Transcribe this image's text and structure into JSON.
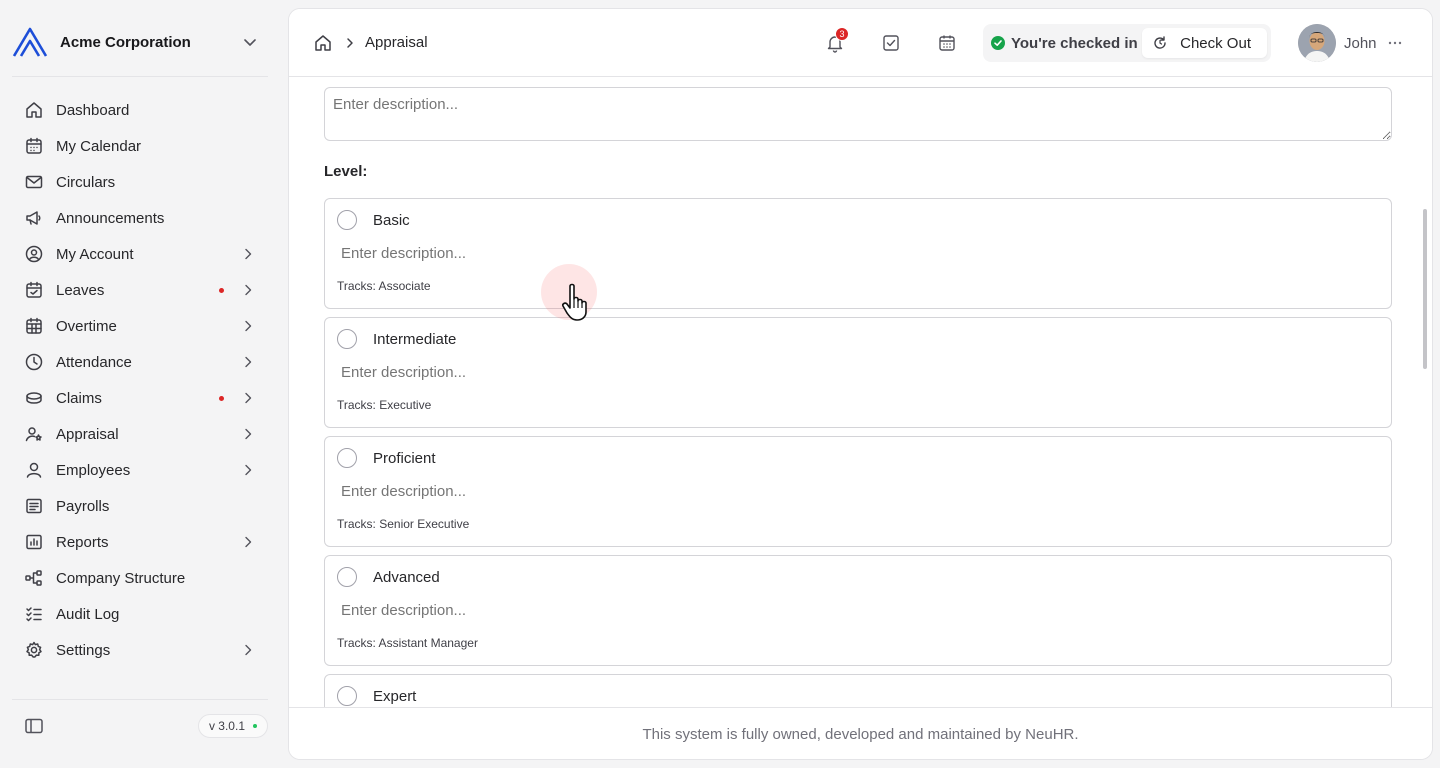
{
  "sidebar": {
    "org_name": "Acme Corporation",
    "items": [
      {
        "label": "Dashboard",
        "icon": "home-icon",
        "dot": false,
        "arrow": false
      },
      {
        "label": "My Calendar",
        "icon": "calendar-icon",
        "dot": false,
        "arrow": false
      },
      {
        "label": "Circulars",
        "icon": "mail-icon",
        "dot": false,
        "arrow": false
      },
      {
        "label": "Announcements",
        "icon": "megaphone-icon",
        "dot": false,
        "arrow": false
      },
      {
        "label": "My Account",
        "icon": "user-circle-icon",
        "dot": false,
        "arrow": true
      },
      {
        "label": "Leaves",
        "icon": "calendar-check-icon",
        "dot": true,
        "arrow": true
      },
      {
        "label": "Overtime",
        "icon": "calendar-grid-icon",
        "dot": false,
        "arrow": true
      },
      {
        "label": "Attendance",
        "icon": "clock-icon",
        "dot": false,
        "arrow": true
      },
      {
        "label": "Claims",
        "icon": "coins-icon",
        "dot": true,
        "arrow": true
      },
      {
        "label": "Appraisal",
        "icon": "user-star-icon",
        "dot": false,
        "arrow": true
      },
      {
        "label": "Employees",
        "icon": "user-icon",
        "dot": false,
        "arrow": true
      },
      {
        "label": "Payrolls",
        "icon": "receipt-icon",
        "dot": false,
        "arrow": false
      },
      {
        "label": "Reports",
        "icon": "chart-icon",
        "dot": false,
        "arrow": true
      },
      {
        "label": "Company Structure",
        "icon": "hierarchy-icon",
        "dot": false,
        "arrow": false
      },
      {
        "label": "Audit Log",
        "icon": "checklist-icon",
        "dot": false,
        "arrow": false
      },
      {
        "label": "Settings",
        "icon": "gear-icon",
        "dot": false,
        "arrow": true
      }
    ],
    "version": "v 3.0.1"
  },
  "header": {
    "breadcrumb_page": "Appraisal",
    "notification_count": "3",
    "checkin_status": "You're checked in",
    "checkout_label": "Check Out",
    "user_name": "John"
  },
  "form": {
    "description_placeholder": "Enter description...",
    "level_label": "Level:",
    "levels": [
      {
        "name": "Basic",
        "placeholder": "Enter description...",
        "tracks": "Tracks: Associate"
      },
      {
        "name": "Intermediate",
        "placeholder": "Enter description...",
        "tracks": "Tracks: Executive"
      },
      {
        "name": "Proficient",
        "placeholder": "Enter description...",
        "tracks": "Tracks: Senior Executive"
      },
      {
        "name": "Advanced",
        "placeholder": "Enter description...",
        "tracks": "Tracks: Assistant Manager"
      },
      {
        "name": "Expert",
        "placeholder": "Enter description...",
        "tracks": ""
      }
    ]
  },
  "footer": {
    "text": "This system is fully owned, developed and maintained by NeuHR."
  },
  "colors": {
    "accent": "#2563eb",
    "dot_red": "#dc2626",
    "online_green": "#16a34a"
  }
}
